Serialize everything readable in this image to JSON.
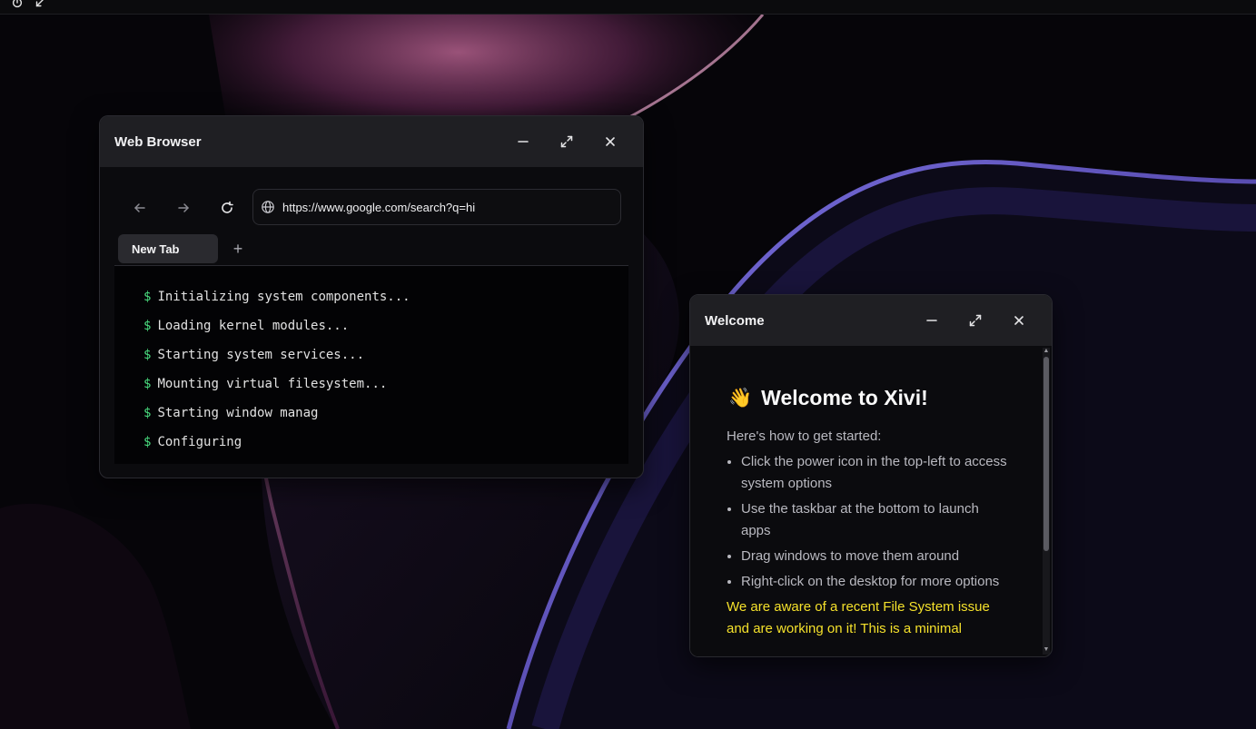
{
  "topbar": {
    "icons": [
      "power-icon",
      "minimize-arrow-icon"
    ]
  },
  "browser": {
    "title": "Web Browser",
    "url": "https://www.google.com/search?q=hi",
    "tabs": [
      {
        "label": "New Tab"
      }
    ],
    "new_tab_symbol": "+",
    "terminal": {
      "prompt": "$",
      "lines": [
        "Initializing system components...",
        "Loading kernel modules...",
        "Starting system services...",
        "Mounting virtual filesystem...",
        "Starting window manag",
        "Configuring"
      ]
    }
  },
  "welcome": {
    "title": "Welcome",
    "emoji": "👋",
    "heading": "Welcome to Xivi!",
    "intro": "Here's how to get started:",
    "tips": [
      "Click the power icon in the top-left to access system options",
      "Use the taskbar at the bottom to launch apps",
      "Drag windows to move them around",
      "Right-click on the desktop for more options"
    ],
    "notice": "We are aware of a recent File System issue and are working on it! This is a minimal"
  },
  "colors": {
    "prompt": "#4ade80",
    "notice": "#f5e12b",
    "titlebar": "#1f1f23",
    "window_bg": "#0b0b0e"
  }
}
